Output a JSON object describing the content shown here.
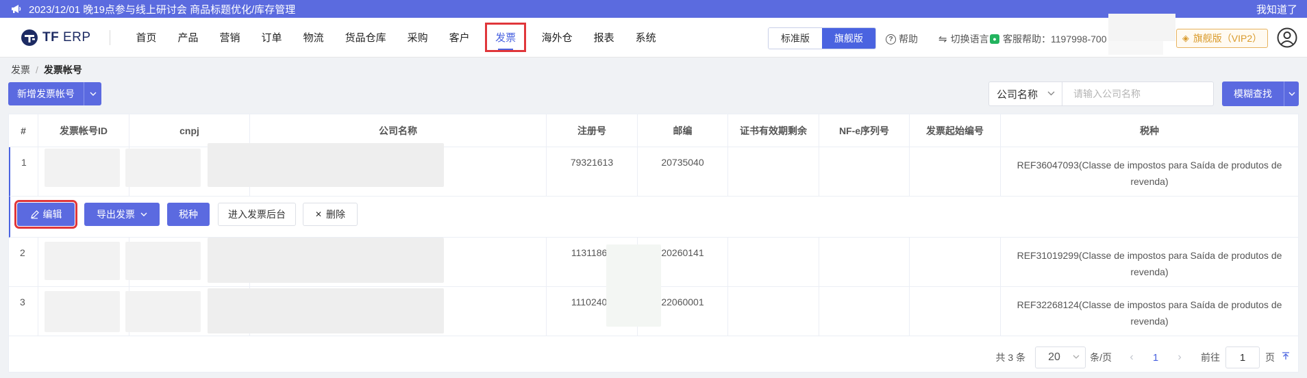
{
  "notice": {
    "text": "2023/12/01 晚19点参与线上研讨会 商品标题优化/库存管理",
    "dismiss": "我知道了"
  },
  "logo": {
    "brand": "TF",
    "suffix": "ERP"
  },
  "nav": [
    "首页",
    "产品",
    "营销",
    "订单",
    "物流",
    "货品仓库",
    "采购",
    "客户",
    "发票",
    "海外仓",
    "报表",
    "系统"
  ],
  "nav_active": "发票",
  "edition": {
    "standard": "标准版",
    "flagship": "旗舰版"
  },
  "help": "帮助",
  "language": "切换语言",
  "service": "客服帮助：1197998-700",
  "vip": "旗舰版（VIP2）",
  "breadcrumb": {
    "parent": "发票",
    "current": "发票帐号"
  },
  "toolbar": {
    "add": "新增发票帐号",
    "company_select": "公司名称",
    "company_placeholder": "请输入公司名称",
    "search": "模糊查找"
  },
  "table": {
    "headers": [
      "#",
      "发票帐号ID",
      "cnpj",
      "公司名称",
      "注册号",
      "邮编",
      "证书有效期剩余",
      "NF-e序列号",
      "发票起始编号",
      "税种"
    ],
    "rows": [
      {
        "idx": "1",
        "reg": "79321613",
        "zip": "20735040",
        "tax": "REF36047093(Classe de impostos para Saída de produtos de revenda)"
      },
      {
        "idx": "2",
        "reg": "11311865",
        "zip": "20260141",
        "tax": "REF31019299(Classe de impostos para Saída de produtos de revenda)"
      },
      {
        "idx": "3",
        "reg": "11102409",
        "zip": "22060001",
        "tax": "REF32268124(Classe de impostos para Saída de produtos de revenda)"
      }
    ],
    "actions": {
      "edit": "编辑",
      "export": "导出发票",
      "tax": "税种",
      "enter": "进入发票后台",
      "delete": "删除"
    }
  },
  "pager": {
    "total": "共 3 条",
    "size": "20",
    "per": "条/页",
    "page": "1",
    "goto": "前往",
    "goto_value": "1",
    "page_unit": "页"
  }
}
